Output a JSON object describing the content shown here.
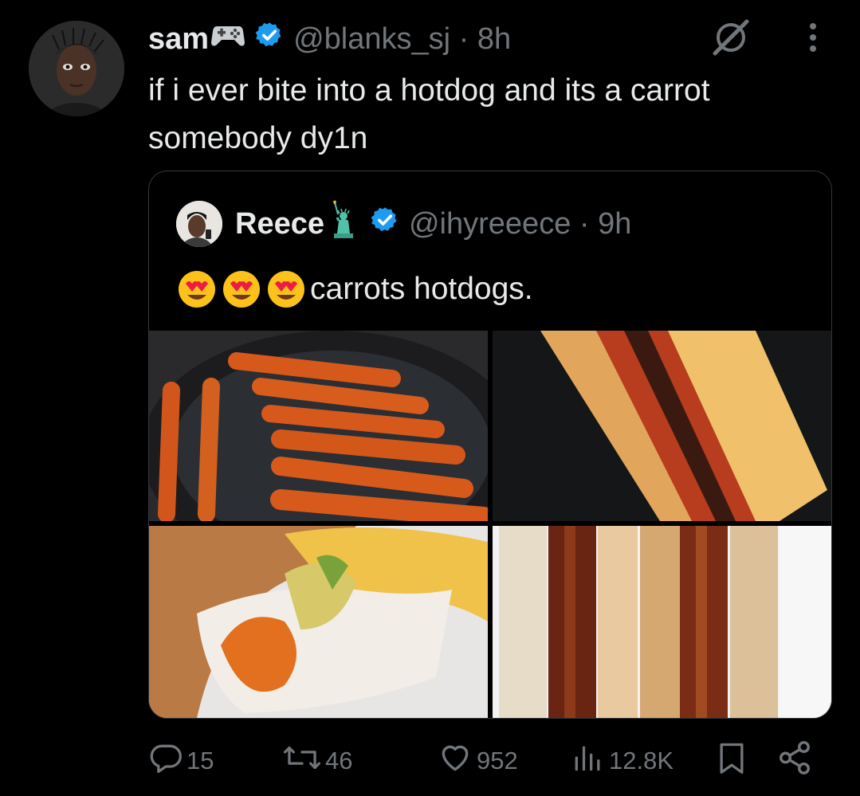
{
  "tweet": {
    "display_name": "sam",
    "name_emoji": "game-controller",
    "verified": true,
    "handle_time": "@blanks_sj · 8h",
    "text": "if i ever bite into a hotdog and its a carrot somebody dy1n"
  },
  "quote": {
    "display_name": "Reece",
    "name_emoji": "statue-of-liberty",
    "verified": true,
    "handle_time": "@ihyreeece · 9h",
    "emojis": [
      "smiling-face-with-heart-eyes",
      "smiling-face-with-heart-eyes",
      "smiling-face-with-heart-eyes"
    ],
    "text": "carrots hotdogs.",
    "images": [
      {
        "name": "carrots-in-pan"
      },
      {
        "name": "hotdog-in-bun"
      },
      {
        "name": "bitten-carrot-hotdog"
      },
      {
        "name": "two-hotdogs-on-plate"
      }
    ]
  },
  "actions": {
    "replies": "15",
    "reposts": "46",
    "likes": "952",
    "views": "12.8K"
  },
  "colors": {
    "background": "#000000",
    "text": "#e7e9ea",
    "muted": "#71767b",
    "verified": "#1d9bf0",
    "border": "#333639"
  }
}
